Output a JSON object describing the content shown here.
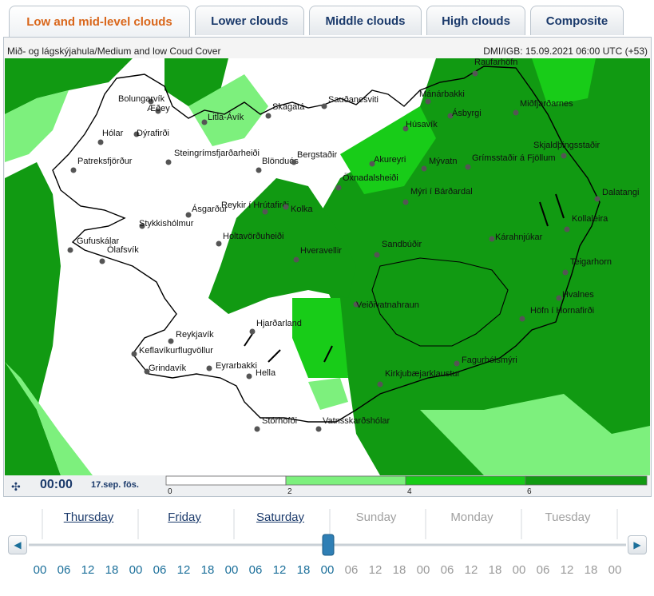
{
  "tabs": [
    {
      "label": "Low and mid-level clouds",
      "active": true
    },
    {
      "label": "Lower clouds",
      "active": false
    },
    {
      "label": "Middle clouds",
      "active": false
    },
    {
      "label": "High clouds",
      "active": false
    },
    {
      "label": "Composite",
      "active": false
    }
  ],
  "header": {
    "title": "Mið- og lágskýjahula/Medium and low Coud Cover",
    "run_info": "DMI/IGB: 15.09.2021 06:00 UTC (+53)"
  },
  "colors": {
    "dark_green": "#119a12",
    "mid_green": "#18cc18",
    "light_green": "#7df07d",
    "white": "#ffffff",
    "accent_tab": "#d9661a",
    "link": "#1b3a6b"
  },
  "places": [
    "Raufarhöfn",
    "Bolungarvík",
    "Æðey",
    "Hólar",
    "Dýrafirði",
    "Patreksfjörður",
    "Litla-Ávík",
    "Skagatá",
    "Sauðanesviti",
    "Mánárbakki",
    "Miðfjarðarnes",
    "Húsavík",
    "Ásbyrgi",
    "Steingrímsfjarðarheiði",
    "Blönduós",
    "Bergstaðir",
    "Akureyri",
    "Mývatn",
    "Grímsstaðir á Fjöllum",
    "Skjaldþingsstaðir",
    "Öxnadalsheiði",
    "Mýri í Bárðardal",
    "Dalatangi",
    "Ásgarður",
    "Reykir í Hrútafirði",
    "Kolka",
    "Kollaleira",
    "Stykkishólmur",
    "Gufuskálar",
    "Ólafsvík",
    "Hveravellir",
    "Sandbúðir",
    "Kárahnjúkar",
    "Teigarhorn",
    "Holtavörðuheiði",
    "Veiðivatnahraun",
    "Hvalnes",
    "Höfn í Hornafirði",
    "Hjarðarland",
    "Reykjavík",
    "Keflavíkurflugvöllur",
    "Grindavík",
    "Eyrarbakki",
    "Hella",
    "Fagurhólsmýri",
    "Kirkjubæjarklaustur",
    "Stórhöfði",
    "Vatnsskarðshólar"
  ],
  "player": {
    "time": "00:00",
    "date": "17.sep. fös."
  },
  "legend": {
    "ticks": [
      "0",
      "2",
      "4",
      "6"
    ],
    "colors": [
      "#ffffff",
      "#7df07d",
      "#18cc18",
      "#119a12"
    ]
  },
  "timeline": {
    "days": [
      {
        "label": "Thursday",
        "available": true
      },
      {
        "label": "Friday",
        "available": true
      },
      {
        "label": "Saturday",
        "available": true
      },
      {
        "label": "Sunday",
        "available": false
      },
      {
        "label": "Monday",
        "available": false
      },
      {
        "label": "Tuesday",
        "available": false
      }
    ],
    "hours": [
      "00",
      "06",
      "12",
      "18",
      "00",
      "06",
      "12",
      "18",
      "00",
      "06",
      "12",
      "18",
      "00",
      "06",
      "12",
      "18",
      "00",
      "06",
      "12",
      "18",
      "00",
      "06",
      "12",
      "18",
      "00"
    ],
    "selected_index": 12
  }
}
